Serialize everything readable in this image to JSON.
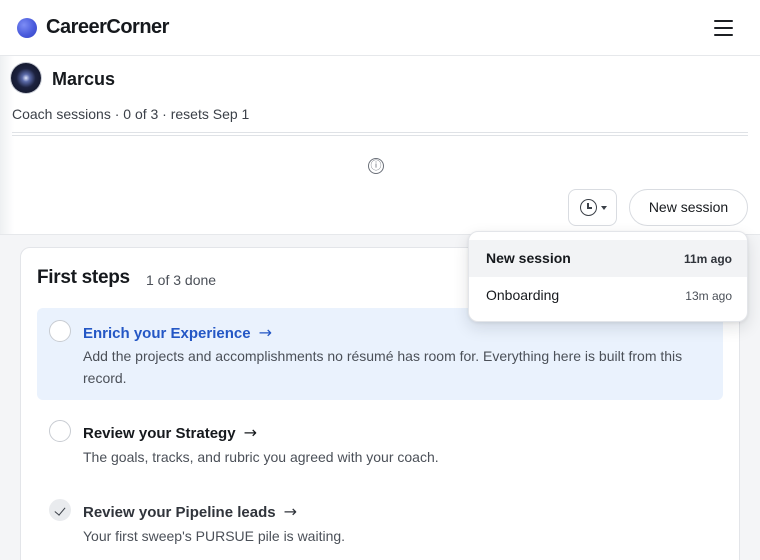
{
  "app": {
    "name": "CareerCorner"
  },
  "header": {
    "menu_icon": "hamburger-icon"
  },
  "profile": {
    "name": "Marcus",
    "session_info": "Coach sessions · 0 of 3 · resets Sep 1",
    "info_icon": "ⓘ"
  },
  "toolbar": {
    "history_icon": "clock-icon",
    "new_session_label": "New session"
  },
  "session_menu": {
    "items": [
      {
        "label": "New session",
        "time": "11m ago",
        "selected": true
      },
      {
        "label": "Onboarding",
        "time": "13m ago",
        "selected": false
      }
    ]
  },
  "first_steps": {
    "title": "First steps",
    "progress": "1 of 3 done",
    "steps": [
      {
        "title": "Enrich your Experience",
        "arrow": "→",
        "description": "Add the projects and accomplishments no résumé has room for. Everything here is built from this record.",
        "done": false
      },
      {
        "title": "Review your Strategy",
        "arrow": "→",
        "description": "The goals, tracks, and rubric you agreed with your coach.",
        "done": false
      },
      {
        "title": "Review your Pipeline leads",
        "arrow": "→",
        "description": "Your first sweep's PURSUE pile is waiting.",
        "done": true
      }
    ]
  }
}
